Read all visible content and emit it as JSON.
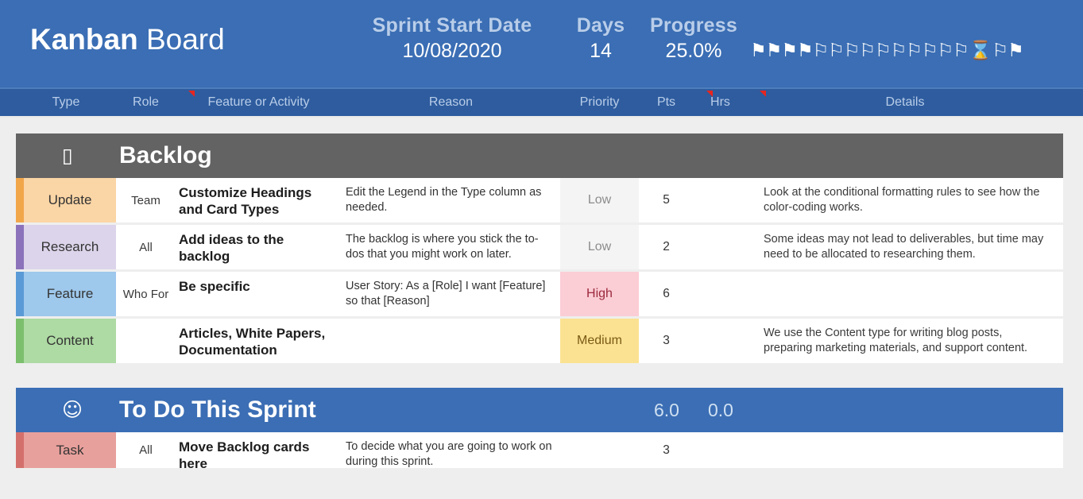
{
  "header": {
    "brand_strong": "Kanban",
    "brand_light": "Board",
    "sprint_label": "Sprint Start Date",
    "sprint_value": "10/08/2020",
    "days_label": "Days",
    "days_value": "14",
    "progress_label": "Progress",
    "progress_value": "25.0%",
    "progress_filled_flags": 4,
    "progress_empty_flags": 10,
    "progress_hourglass_icon": "hourglass-icon",
    "progress_finish_icon": "checkered-flag-icon",
    "band_color": "#3b6eb4",
    "label_color": "#b9cde9"
  },
  "columns": [
    {
      "label": "Type",
      "has_comment_marker": false
    },
    {
      "label": "Role",
      "has_comment_marker": true
    },
    {
      "label": "Feature or Activity",
      "has_comment_marker": false
    },
    {
      "label": "Reason",
      "has_comment_marker": false
    },
    {
      "label": "Priority",
      "has_comment_marker": false
    },
    {
      "label": "Pts",
      "has_comment_marker": true
    },
    {
      "label": "Hrs",
      "has_comment_marker": true
    },
    {
      "label": "Details",
      "has_comment_marker": false
    }
  ],
  "sections": [
    {
      "id": "backlog",
      "icon": "missing-glyph-icon",
      "icon_char": "▯",
      "title": "Backlog",
      "pts_total": "",
      "hrs_total": "",
      "header_color": "#636363",
      "rows": [
        {
          "type": "Update",
          "type_style": "update",
          "role": "Team",
          "feature": "Customize Headings and Card Types",
          "reason": "Edit the Legend in the Type column as needed.",
          "priority": "Low",
          "priority_style": "low",
          "pts": "5",
          "hrs": "",
          "details": "Look at the conditional formatting rules to see how the color-coding works."
        },
        {
          "type": "Research",
          "type_style": "research",
          "role": "All",
          "feature": "Add ideas to the backlog",
          "reason": "The backlog is where you stick the to-dos that you might work on later.",
          "priority": "Low",
          "priority_style": "low",
          "pts": "2",
          "hrs": "",
          "details": "Some ideas may not lead to deliverables, but time may need to be allocated to researching them."
        },
        {
          "type": "Feature",
          "type_style": "feature",
          "role": "Who For",
          "feature": "Be specific",
          "reason": "User Story: As a [Role] I want [Feature] so that [Reason]",
          "priority": "High",
          "priority_style": "high",
          "pts": "6",
          "hrs": "",
          "details": ""
        },
        {
          "type": "Content",
          "type_style": "content",
          "role": "",
          "feature": "Articles, White Papers, Documentation",
          "reason": "",
          "priority": "Medium",
          "priority_style": "medium",
          "pts": "3",
          "hrs": "",
          "details": "We use the Content type for writing blog posts, preparing marketing materials, and support content."
        }
      ]
    },
    {
      "id": "todo",
      "icon": "neutral-face-icon",
      "icon_char": "☺",
      "title": "To Do This Sprint",
      "pts_total": "6.0",
      "hrs_total": "0.0",
      "header_color": "#3b6eb4",
      "rows": [
        {
          "type": "Task",
          "type_style": "task",
          "role": "All",
          "feature": "Move Backlog cards here",
          "reason": "To decide what you are going to work on during this sprint.",
          "priority": "",
          "priority_style": "none",
          "pts": "3",
          "hrs": "",
          "details": ""
        }
      ]
    }
  ]
}
